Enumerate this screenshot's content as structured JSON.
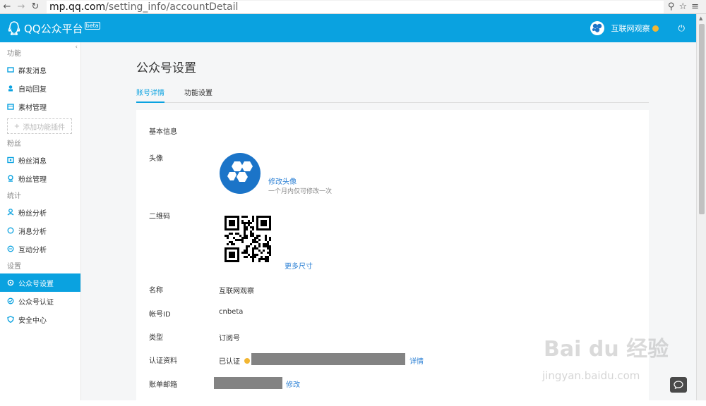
{
  "browser": {
    "url_host": "mp.qq.com",
    "url_path": "/setting_info/accountDetail"
  },
  "topbar": {
    "logo_text": "QQ公众平台",
    "beta": "beta",
    "account_name": "互联网观察"
  },
  "sidebar": {
    "groups": [
      {
        "title": "功能",
        "items": [
          "群发消息",
          "自动回复",
          "素材管理"
        ]
      },
      {
        "title": "粉丝",
        "items": [
          "粉丝消息",
          "粉丝管理"
        ]
      },
      {
        "title": "统计",
        "items": [
          "粉丝分析",
          "消息分析",
          "互动分析"
        ]
      },
      {
        "title": "设置",
        "items": [
          "公众号设置",
          "公众号认证",
          "安全中心"
        ]
      }
    ],
    "add_plugin": "添加功能插件",
    "active_item": "公众号设置"
  },
  "main": {
    "title": "公众号设置",
    "tabs": [
      "账号详情",
      "功能设置"
    ],
    "section_title": "基本信息",
    "avatar": {
      "label": "头像",
      "change_link": "修改头像",
      "hint": "一个月内仅可修改一次"
    },
    "qrcode": {
      "label": "二维码",
      "more_sizes": "更多尺寸"
    },
    "name": {
      "label": "名称",
      "value": "互联网观察"
    },
    "account_id": {
      "label": "帐号ID",
      "value": "cnbeta"
    },
    "type": {
      "label": "类型",
      "value": "订阅号"
    },
    "verification": {
      "label": "认证资料",
      "value": "已认证",
      "detail_link": "详情"
    },
    "billing_email": {
      "label": "账单邮箱",
      "edit_link": "修改"
    }
  },
  "watermark": {
    "text": "Bai du 经验",
    "url": "jingyan.baidu.com"
  },
  "colors": {
    "brand_blue": "#0aa2e0",
    "link_blue": "#2a7fd4",
    "verified_badge": "#f2b632"
  }
}
